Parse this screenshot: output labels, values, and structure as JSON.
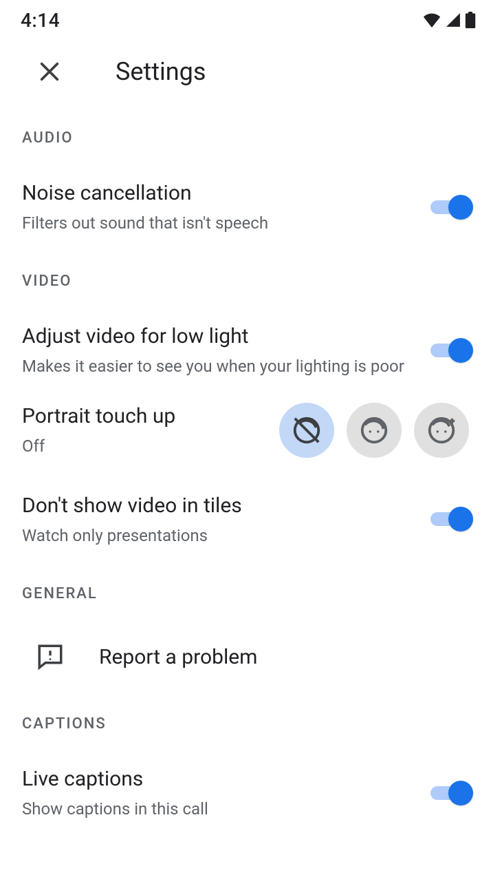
{
  "statusBar": {
    "time": "4:14"
  },
  "header": {
    "title": "Settings"
  },
  "sections": {
    "audio": {
      "label": "AUDIO",
      "noise": {
        "title": "Noise cancellation",
        "subtitle": "Filters out sound that isn't speech",
        "enabled": true
      }
    },
    "video": {
      "label": "VIDEO",
      "lowlight": {
        "title": "Adjust video for low light",
        "subtitle": "Makes it easier to see you when your lighting is poor",
        "enabled": true
      },
      "portrait": {
        "title": "Portrait touch up",
        "value": "Off",
        "selected": "off",
        "options": [
          "off",
          "subtle",
          "smoothing"
        ]
      },
      "tiles": {
        "title": "Don't show video in tiles",
        "subtitle": "Watch only presentations",
        "enabled": true
      }
    },
    "general": {
      "label": "GENERAL",
      "report": {
        "label": "Report a problem"
      }
    },
    "captions": {
      "label": "CAPTIONS",
      "live": {
        "title": "Live captions",
        "subtitle": "Show captions in this call",
        "enabled": true
      }
    }
  }
}
